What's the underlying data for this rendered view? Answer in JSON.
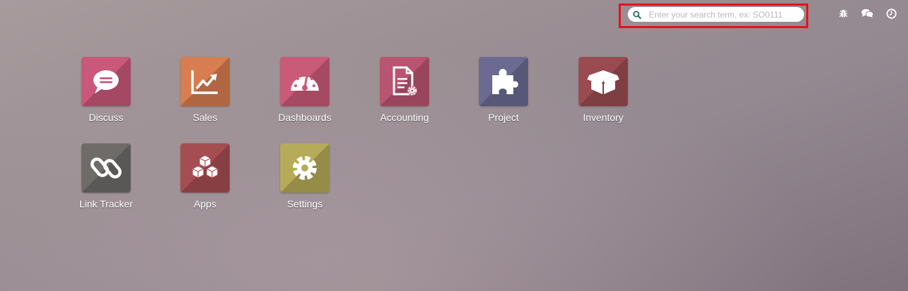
{
  "search": {
    "placeholder": "Enter your search term, ex: SO0111",
    "value": ""
  },
  "systray": {
    "icons": [
      "bug-icon",
      "chat-icon",
      "clock-icon"
    ]
  },
  "apps": [
    {
      "label": "Discuss",
      "icon": "chat-bubble-icon",
      "color": "#c9587a"
    },
    {
      "label": "Sales",
      "icon": "chart-line-icon",
      "color": "#d77d4f"
    },
    {
      "label": "Dashboards",
      "icon": "gauge-icon",
      "color": "#c95a78"
    },
    {
      "label": "Accounting",
      "icon": "document-gear-icon",
      "color": "#b95471"
    },
    {
      "label": "Project",
      "icon": "puzzle-icon",
      "color": "#6a6a92"
    },
    {
      "label": "Inventory",
      "icon": "box-icon",
      "color": "#9a4b50"
    },
    {
      "label": "Link Tracker",
      "icon": "link-icon",
      "color": "#6e6b69"
    },
    {
      "label": "Apps",
      "icon": "cubes-icon",
      "color": "#a64d52"
    },
    {
      "label": "Settings",
      "icon": "gear-icon",
      "color": "#b6ab58"
    }
  ],
  "highlight_color": "#e5121b"
}
